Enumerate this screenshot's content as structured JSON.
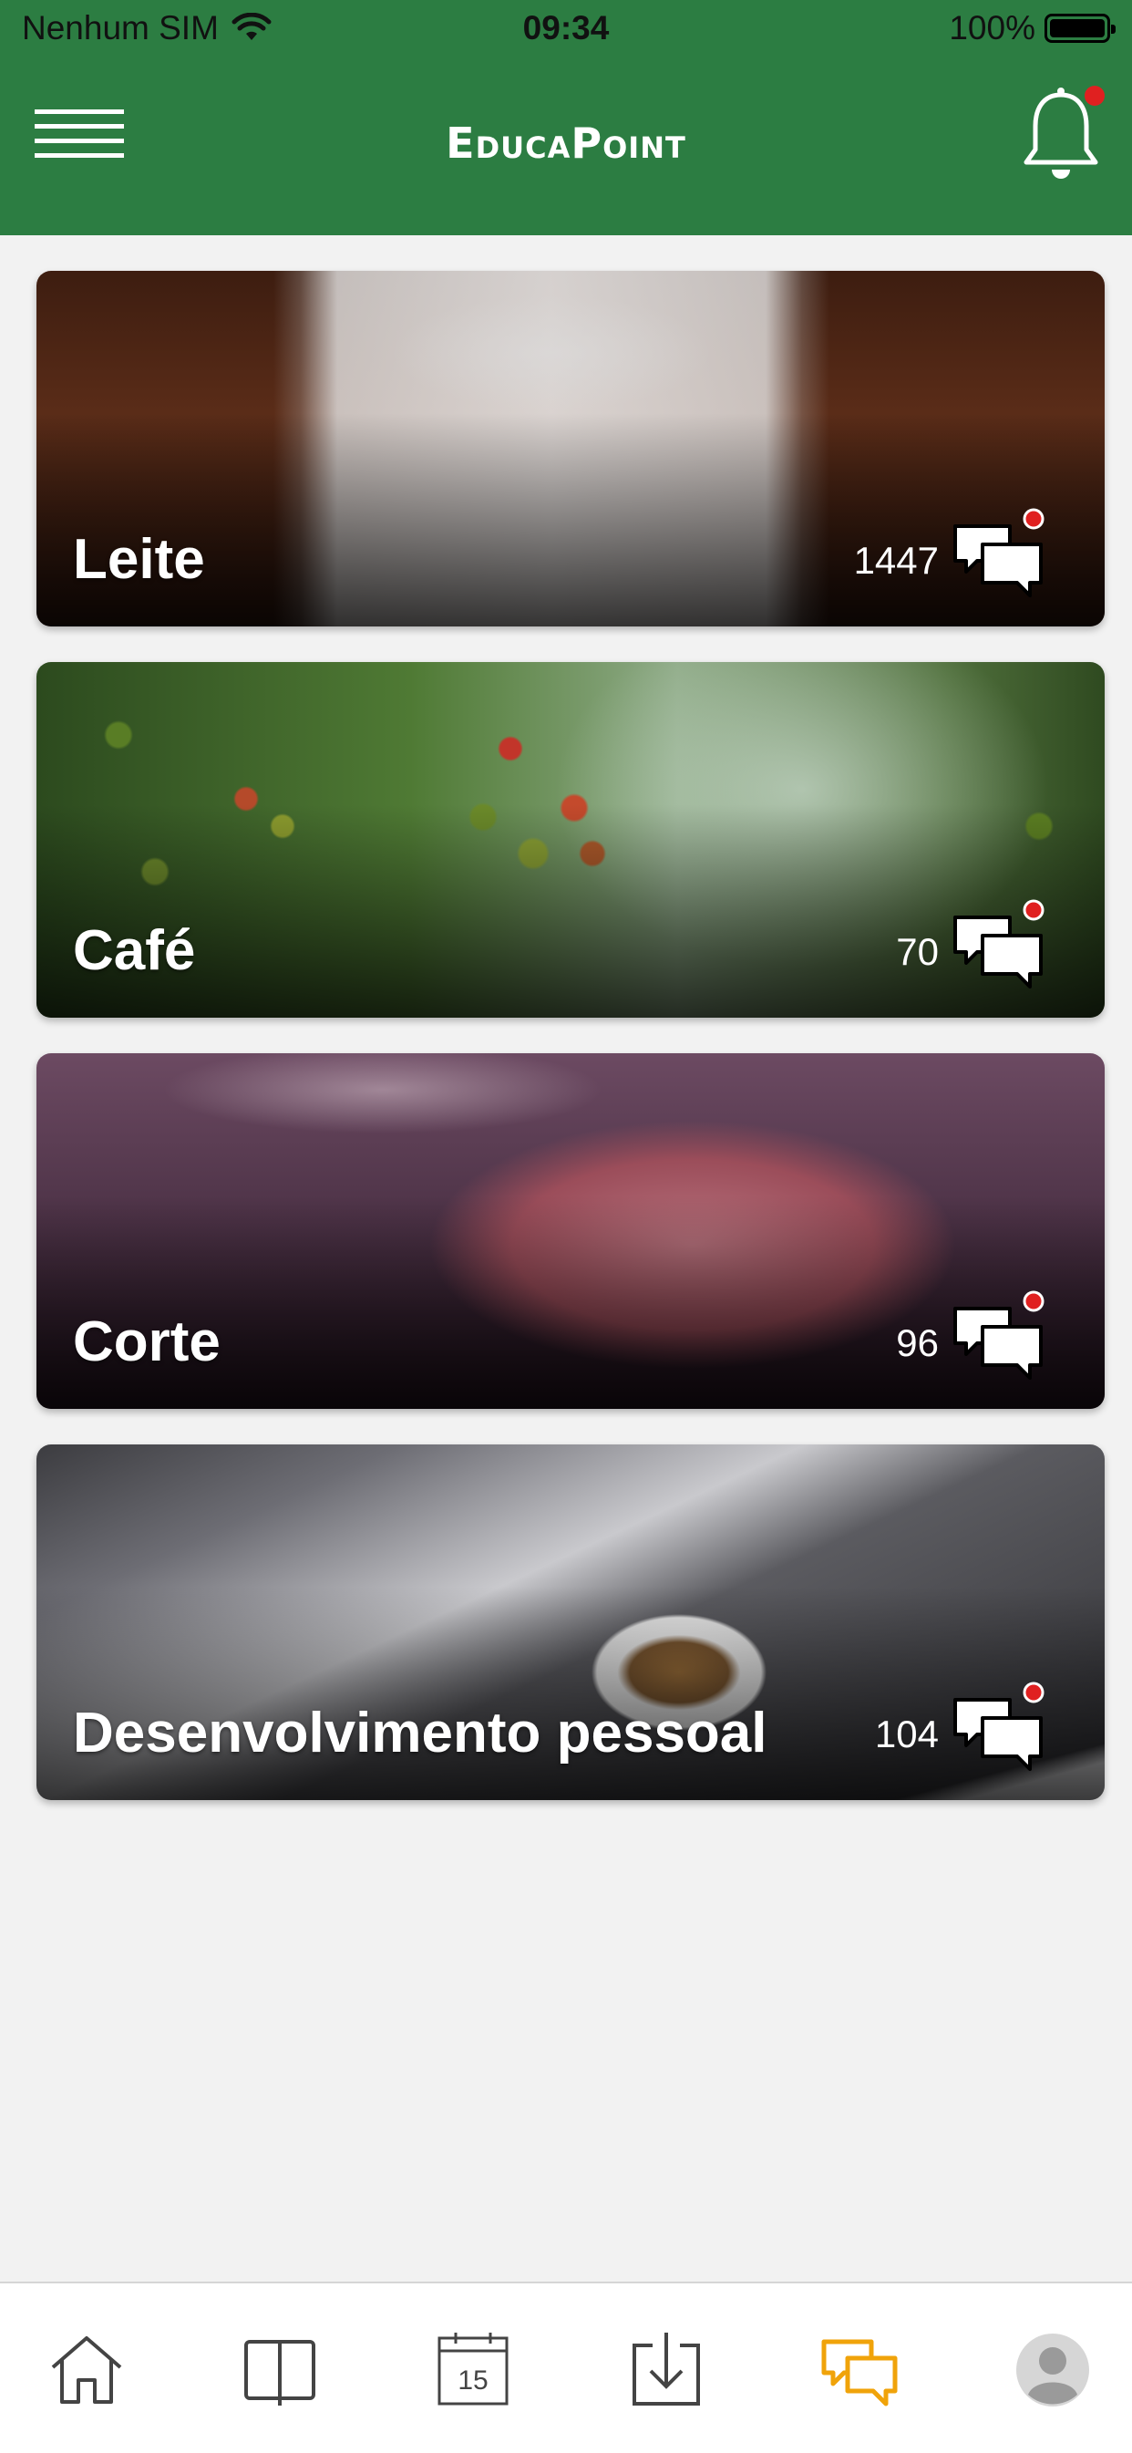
{
  "status_bar": {
    "carrier": "Nenhum SIM",
    "time": "09:34",
    "battery": "100%"
  },
  "header": {
    "logo": "EducaPoint",
    "notification_badge": true
  },
  "cards": [
    {
      "title": "Leite",
      "count": "1447",
      "image": "glass-of-milk"
    },
    {
      "title": "Café",
      "count": "70",
      "image": "coffee-cherries"
    },
    {
      "title": "Corte",
      "count": "96",
      "image": "beef-cut"
    },
    {
      "title": "Desenvolvimento pessoal",
      "count": "104",
      "image": "laptop-and-notebook"
    }
  ],
  "tabbar": {
    "calendar_day": "15",
    "active_tab": "forum",
    "active_color": "#f0a30a",
    "inactive_color": "#444444"
  },
  "colors": {
    "header_bg": "#2c7d42",
    "badge": "#e02020",
    "page_bg": "#f2f2f2"
  },
  "icons": [
    "menu-icon",
    "bell-icon",
    "chat-icon",
    "home-icon",
    "book-icon",
    "calendar-icon",
    "download-icon",
    "forum-icon",
    "profile-icon",
    "wifi-icon",
    "battery-icon"
  ]
}
